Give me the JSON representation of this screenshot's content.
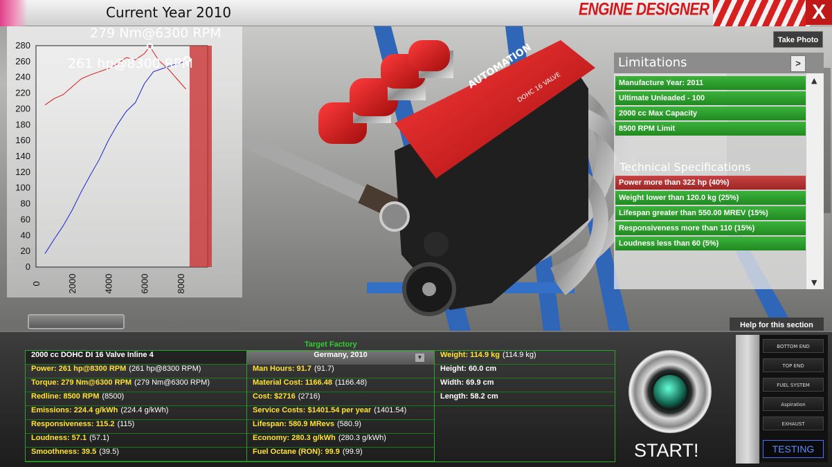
{
  "header": {
    "current_year": "Current Year 2010",
    "app_title": "ENGINE DESIGNER",
    "close_label": "X"
  },
  "graph": {
    "torque_annotation": "279 Nm@6300 RPM",
    "power_annotation": "261 hp@8300 RPM",
    "y_ticks": [
      "280",
      "260",
      "240",
      "220",
      "200",
      "180",
      "160",
      "140",
      "120",
      "100",
      "80",
      "60",
      "40",
      "20",
      "0"
    ],
    "x_ticks": [
      "0",
      "2000",
      "4000",
      "6000",
      "8000"
    ],
    "torque_color": "#d11a1a",
    "power_color": "#1a23cc",
    "redline_color": "#c83232"
  },
  "chart_data": {
    "type": "line",
    "xlim": [
      0,
      9500
    ],
    "ylim": [
      0,
      280
    ],
    "x_ticks": [
      0,
      2000,
      4000,
      6000,
      8000
    ],
    "y_ticks": [
      0,
      20,
      40,
      60,
      80,
      100,
      120,
      140,
      160,
      180,
      200,
      220,
      240,
      260,
      280
    ],
    "redline_start": 8500,
    "series": [
      {
        "name": "Torque",
        "x": [
          500,
          1000,
          1500,
          2000,
          2500,
          3000,
          3500,
          4000,
          4500,
          5000,
          5500,
          6000,
          6300,
          6800,
          7300,
          7800,
          8300
        ],
        "values": [
          205,
          213,
          218,
          228,
          238,
          243,
          247,
          251,
          257,
          265,
          262,
          270,
          279,
          261,
          251,
          238,
          225
        ]
      },
      {
        "name": "Power",
        "x": [
          500,
          1000,
          1500,
          2000,
          2500,
          3000,
          3500,
          4000,
          4500,
          5000,
          5500,
          6000,
          6500,
          7000,
          7500,
          8000,
          8300
        ],
        "values": [
          17,
          35,
          52,
          72,
          95,
          116,
          136,
          160,
          180,
          197,
          208,
          232,
          247,
          251,
          255,
          258,
          261
        ]
      }
    ]
  },
  "toolbar": {
    "take_photo": "Take Photo"
  },
  "limitations": {
    "title": "Limitations",
    "arrow": ">",
    "items": [
      "Manufacture Year: 2011",
      "Ultimate Unleaded - 100",
      "2000 cc Max Capacity",
      "8500 RPM Limit"
    ]
  },
  "technical": {
    "title": "Technical Specifications",
    "items": [
      {
        "label": "Power more than 322 hp (40%)",
        "status": "fail"
      },
      {
        "label": "Weight lower than 120.0 kg (25%)",
        "status": "pass"
      },
      {
        "label": "Lifespan greater than 550.00 MREV (15%)",
        "status": "pass"
      },
      {
        "label": "Responsiveness more than 110 (15%)",
        "status": "pass"
      },
      {
        "label": "Loudness less than 60 (5%)",
        "status": "pass"
      }
    ]
  },
  "help": {
    "label": "Help for this section"
  },
  "stats": {
    "target_title": "Target Factory",
    "engine_name": "2000 cc DOHC DI 16 Valve Inline 4",
    "factory_country": "Germany, 2010",
    "col1": [
      {
        "k": "Power: 261 hp@8300 RPM",
        "v": "(261 hp@8300 RPM)"
      },
      {
        "k": "Torque: 279 Nm@6300 RPM",
        "v": "(279 Nm@6300 RPM)"
      },
      {
        "k": "Redline: 8500 RPM",
        "v": "(8500)"
      },
      {
        "k": "Emissions: 224.4 g/kWh",
        "v": "(224.4 g/kWh)"
      },
      {
        "k": "Responsiveness: 115.2",
        "v": "(115)"
      },
      {
        "k": "Loudness: 57.1",
        "v": "(57.1)"
      },
      {
        "k": "Smoothness: 39.5",
        "v": "(39.5)"
      }
    ],
    "col2": [
      {
        "k": "Man Hours: 91.7",
        "v": "(91.7)"
      },
      {
        "k": "Material Cost: 1166.48",
        "v": "(1166.48)"
      },
      {
        "k": "Cost: $2716",
        "v": "(2716)"
      },
      {
        "k": "Service Costs: $1401.54 per year",
        "v": "(1401.54)"
      },
      {
        "k": "Lifespan: 580.9 MRevs",
        "v": "(580.9)"
      },
      {
        "k": "Economy: 280.3 g/kWh",
        "v": "(280.3 g/kWh)"
      },
      {
        "k": "Fuel Octane (RON): 99.9",
        "v": "(99.9)"
      }
    ],
    "col3": [
      {
        "k": "Weight: 114.9 kg",
        "v": "(114.9 kg)",
        "highlight": true
      },
      {
        "k": "Height: 60.0 cm",
        "v": "",
        "highlight": false
      },
      {
        "k": "Width: 69.9 cm",
        "v": "",
        "highlight": false
      },
      {
        "k": "Length: 58.2 cm",
        "v": "",
        "highlight": false
      }
    ]
  },
  "start": {
    "label": "START!"
  },
  "side_menu": {
    "items": [
      "BOTTOM END",
      "TOP END",
      "FUEL SYSTEM",
      "Aspiration",
      "EXHAUST"
    ],
    "active_tab": "TESTING"
  },
  "scene_labels": {
    "valve_cover_brand": "AUTOMATION",
    "valve_cover_text": "DOHC 16 VALVE"
  }
}
